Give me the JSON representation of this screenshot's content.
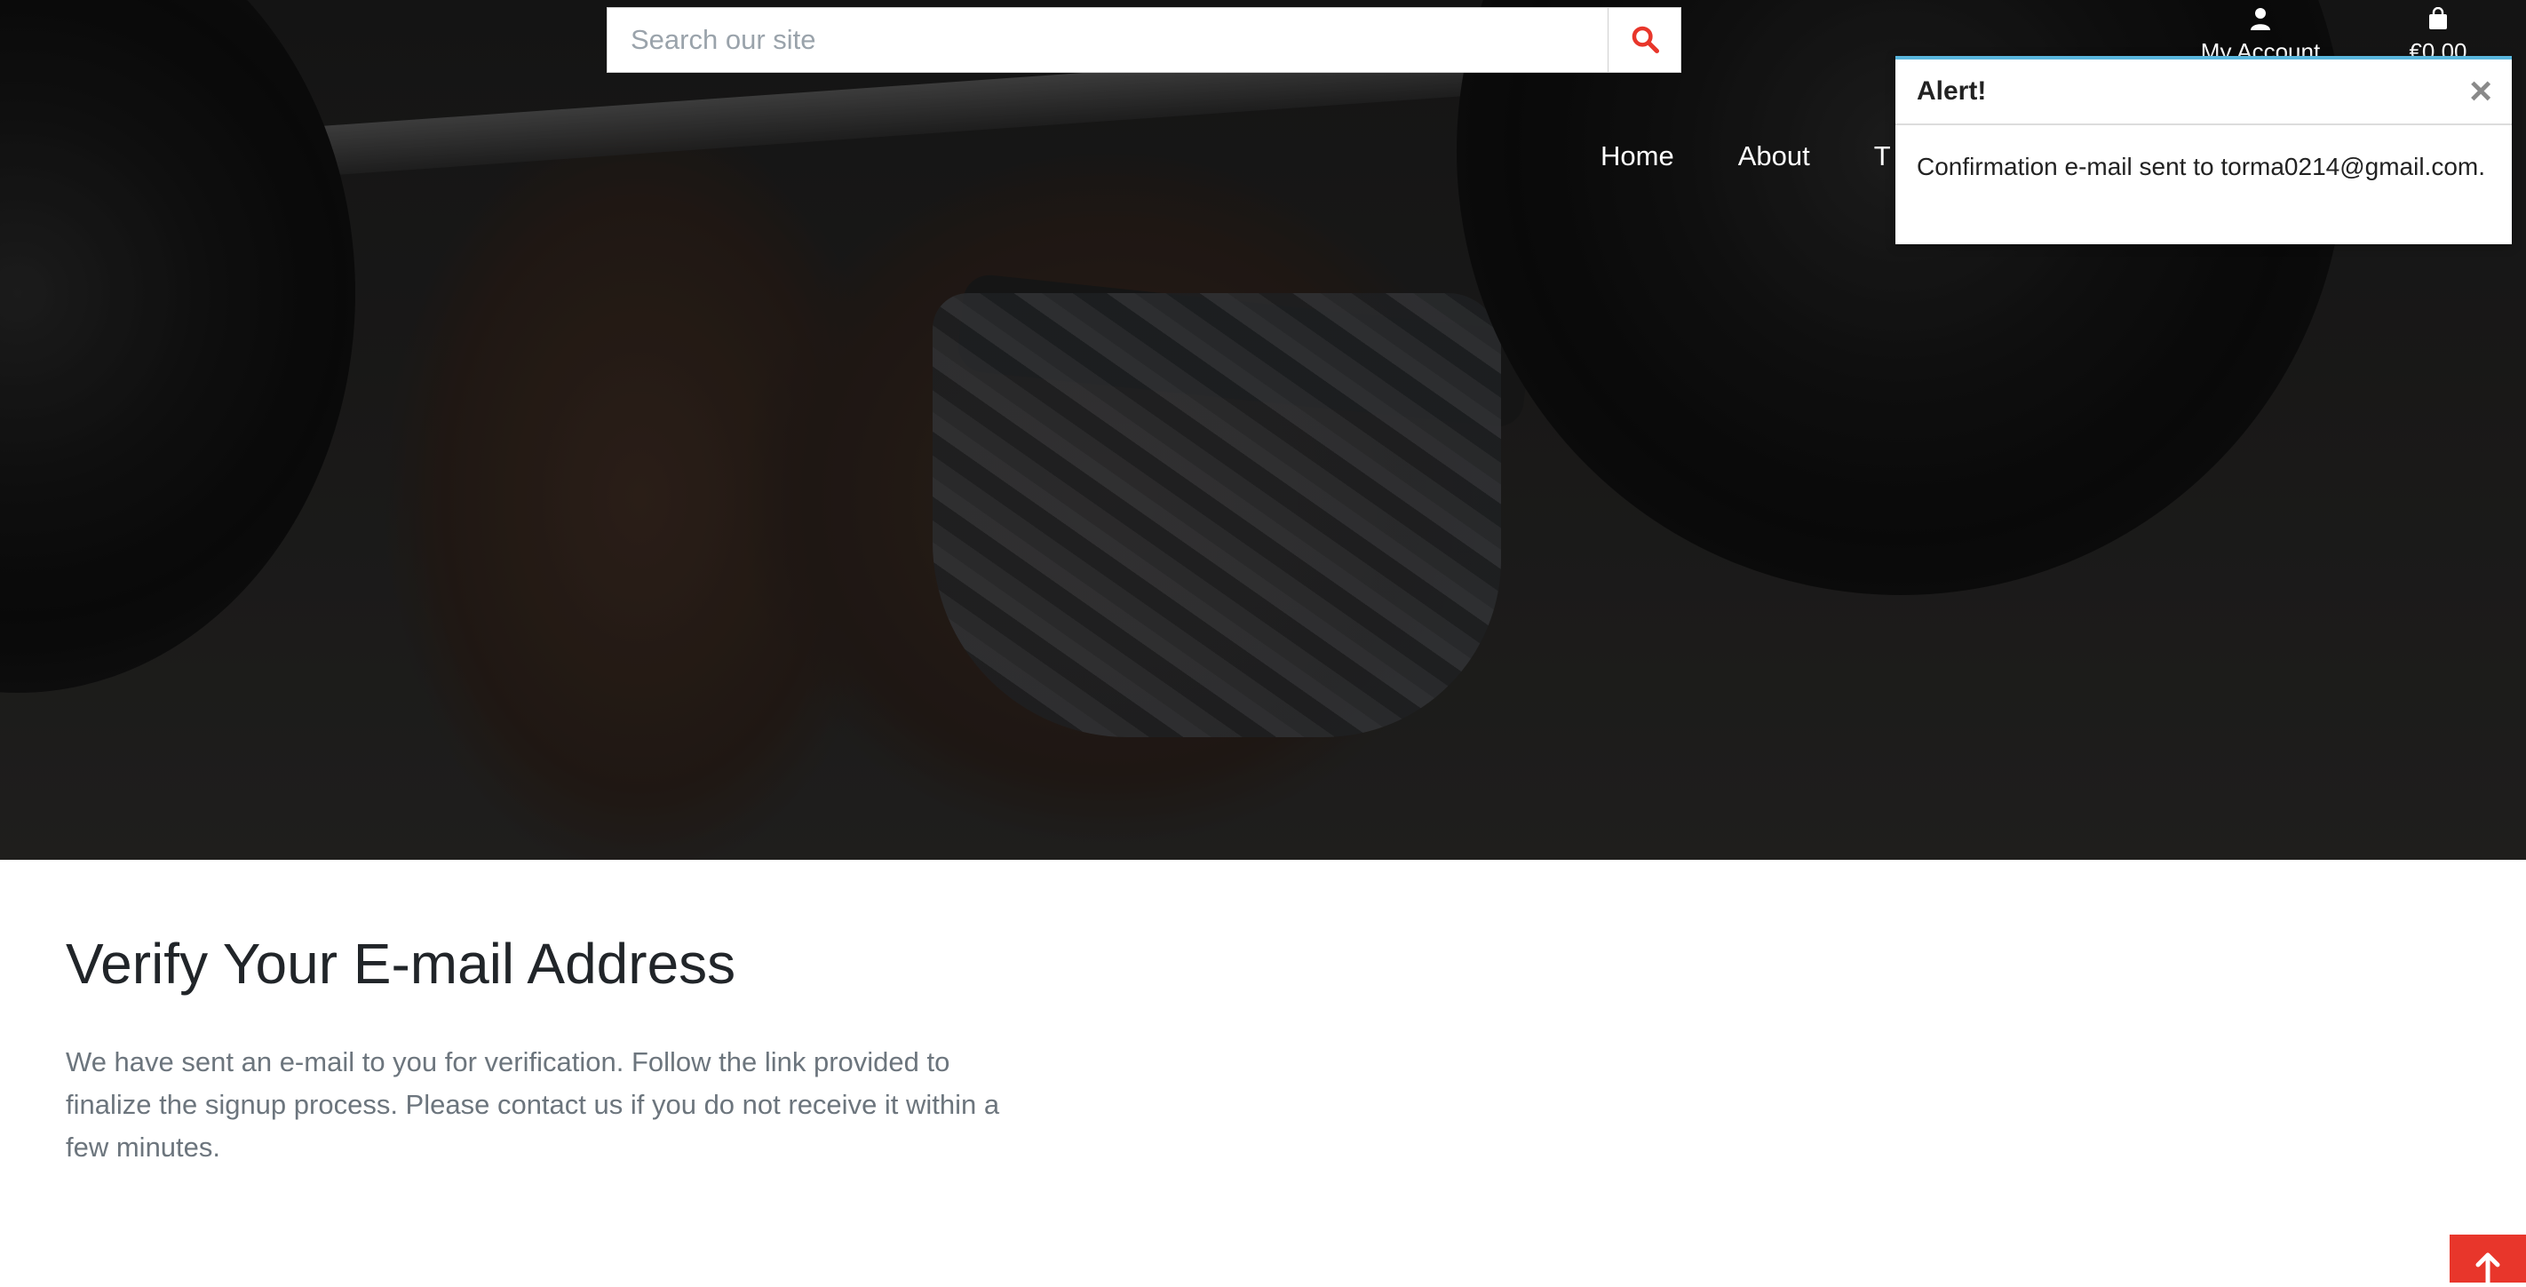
{
  "search": {
    "placeholder": "Search our site",
    "icon": "search-icon"
  },
  "header": {
    "account_label": "My Account",
    "cart_label": "€0.00"
  },
  "nav": {
    "items": [
      "Home",
      "About",
      "T"
    ]
  },
  "alert": {
    "title": "Alert!",
    "message": "Confirmation e-mail sent to torma0214@gmail.com.",
    "accent_color": "#59b6dd"
  },
  "main": {
    "title": "Verify Your E-mail Address",
    "text": "We have sent an e-mail to you for verification. Follow the link provided to finalize the signup process. Please contact us if you do not receive it within a few minutes."
  },
  "colors": {
    "brand_red": "#e8362b",
    "heading": "#212529",
    "body_text": "#6c757d"
  }
}
